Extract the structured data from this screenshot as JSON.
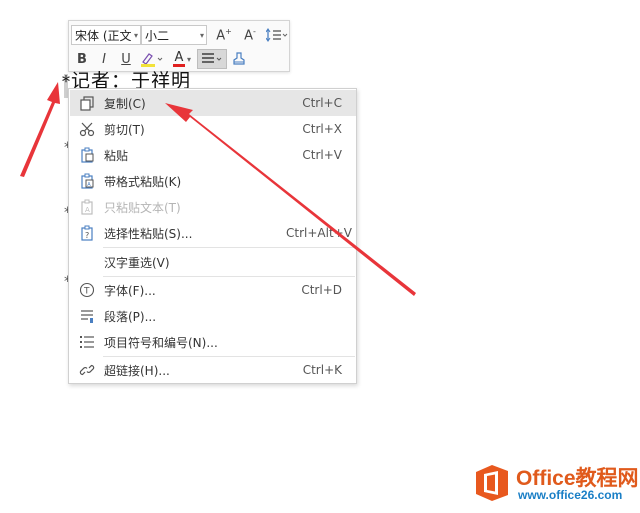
{
  "toolbar": {
    "font_name": "宋体 (正文",
    "font_size": "小二",
    "grow_font": "A+",
    "shrink_font": "A-",
    "bold": "B",
    "italic": "I",
    "underline": "U",
    "font_color_letter": "A"
  },
  "document": {
    "line1": "记者：于祥明",
    "margin_mark": "*"
  },
  "context_menu": {
    "items": [
      {
        "label": "复制(C)",
        "shortcut": "Ctrl+C",
        "icon": "copy-icon"
      },
      {
        "label": "剪切(T)",
        "shortcut": "Ctrl+X",
        "icon": "scissors-icon"
      },
      {
        "label": "粘贴",
        "shortcut": "Ctrl+V",
        "icon": "paste-icon"
      },
      {
        "label": "带格式粘贴(K)",
        "shortcut": "",
        "icon": "paste-format-icon"
      },
      {
        "label": "只粘贴文本(T)",
        "shortcut": "",
        "icon": "paste-text-icon"
      },
      {
        "label": "选择性粘贴(S)...",
        "shortcut": "Ctrl+Alt+V",
        "icon": "paste-special-icon"
      },
      {
        "label": "汉字重选(V)",
        "shortcut": "",
        "icon": ""
      },
      {
        "label": "字体(F)...",
        "shortcut": "Ctrl+D",
        "icon": "font-icon"
      },
      {
        "label": "段落(P)...",
        "shortcut": "",
        "icon": "paragraph-icon"
      },
      {
        "label": "项目符号和编号(N)...",
        "shortcut": "",
        "icon": "bullets-icon"
      },
      {
        "label": "超链接(H)...",
        "shortcut": "Ctrl+K",
        "icon": "link-icon"
      }
    ]
  },
  "watermark": {
    "title": "Office教程网",
    "url": "www.office26.com"
  },
  "colors": {
    "arrow": "#e8353a",
    "highlight": "#e6e6e6",
    "watermark_orange": "#e05a1c",
    "watermark_blue": "#1a7fc6"
  }
}
